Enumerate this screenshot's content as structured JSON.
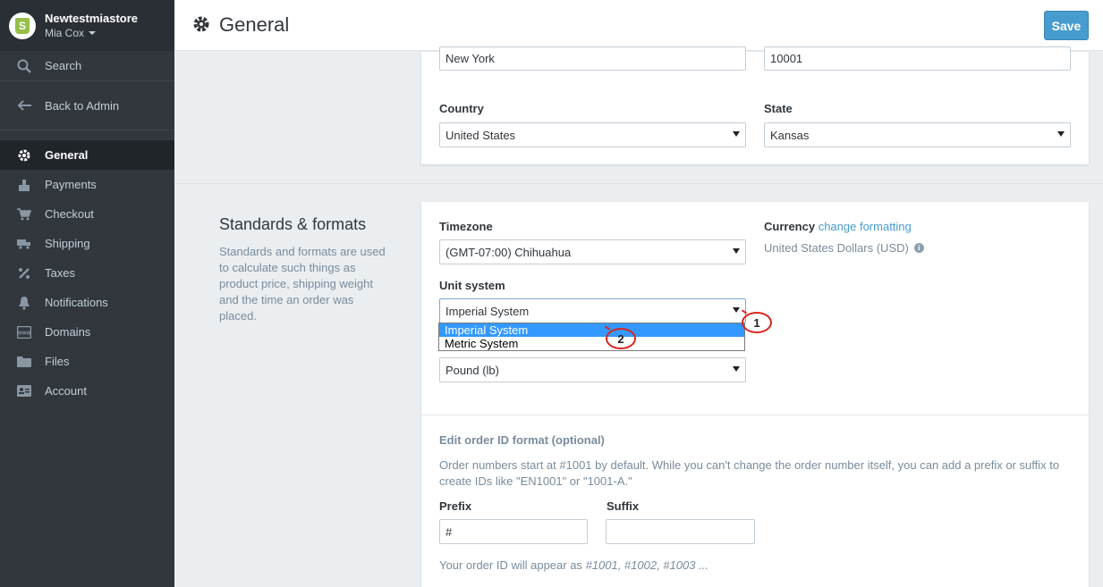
{
  "store": {
    "name": "Newtestmiastore",
    "user": "Mia Cox"
  },
  "sidebar": {
    "search_label": "Search",
    "back_label": "Back to Admin",
    "items": [
      {
        "label": "General",
        "icon": "gear-icon",
        "active": true
      },
      {
        "label": "Payments",
        "icon": "payments-icon",
        "active": false
      },
      {
        "label": "Checkout",
        "icon": "cart-icon",
        "active": false
      },
      {
        "label": "Shipping",
        "icon": "truck-icon",
        "active": false
      },
      {
        "label": "Taxes",
        "icon": "percent-icon",
        "active": false
      },
      {
        "label": "Notifications",
        "icon": "bell-icon",
        "active": false
      },
      {
        "label": "Domains",
        "icon": "www-icon",
        "active": false
      },
      {
        "label": "Files",
        "icon": "folder-icon",
        "active": false
      },
      {
        "label": "Account",
        "icon": "id-card-icon",
        "active": false
      }
    ]
  },
  "header": {
    "title": "General",
    "save_label": "Save"
  },
  "address": {
    "city_value": "New York",
    "zip_value": "10001",
    "country_label": "Country",
    "country_value": "United States",
    "state_label": "State",
    "state_value": "Kansas"
  },
  "standards": {
    "title": "Standards & formats",
    "description": "Standards and formats are used to calculate such things as product price, shipping weight and the time an order was placed.",
    "timezone_label": "Timezone",
    "timezone_value": "(GMT-07:00) Chihuahua",
    "unit_label": "Unit system",
    "unit_value": "Imperial System",
    "unit_options": [
      "Imperial System",
      "Metric System"
    ],
    "weight_value": "Pound (lb)",
    "currency_label": "Currency",
    "currency_link": "change formatting",
    "currency_value": "United States Dollars (USD)"
  },
  "annotations": [
    "1",
    "2"
  ],
  "order_id": {
    "title": "Edit order ID format (optional)",
    "description": "Order numbers start at #1001 by default. While you can't change the order number itself, you can add a prefix or suffix to create IDs like \"EN1001\" or \"1001-A.\"",
    "prefix_label": "Prefix",
    "prefix_value": "#",
    "suffix_label": "Suffix",
    "suffix_value": "",
    "hint_prefix": "Your order ID will appear as ",
    "hint_examples": "#1001, #1002, #1003 ..."
  },
  "colors": {
    "sidebar_bg": "#31373d",
    "accent": "#479ccf",
    "dropdown_highlight": "#3399ff",
    "annotation": "#d9251d"
  }
}
